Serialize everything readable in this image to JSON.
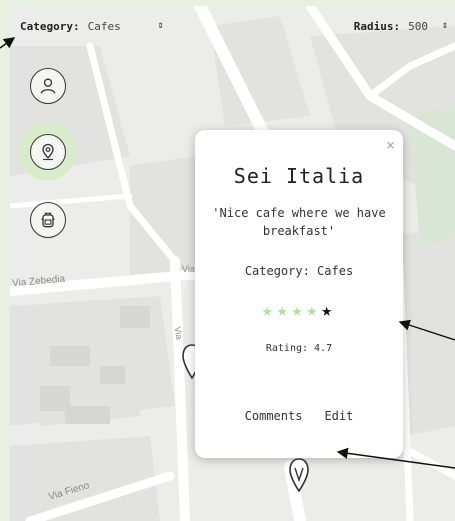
{
  "topbar": {
    "category_label": "Category:",
    "category_value": "Cafes",
    "radius_label": "Radius:",
    "radius_value": "500",
    "spinner_glyph": "⇕"
  },
  "sidebar": {
    "items": [
      {
        "name": "profile",
        "icon": "user-icon"
      },
      {
        "name": "places",
        "icon": "map-pin-icon",
        "active": true
      },
      {
        "name": "trips",
        "icon": "backpack-icon"
      }
    ],
    "active_color": "#d9ecc9"
  },
  "map": {
    "street_labels": [
      "Via Zebedia",
      "Via Fieno",
      "Via",
      "Via"
    ]
  },
  "popup": {
    "close": "×",
    "title": "Sei Italia",
    "quote": "'Nice cafe where we have breakfast'",
    "category": "Category: Cafes",
    "stars_filled": 4,
    "stars_total": 5,
    "star_glyph": "★",
    "rating": "Rating: 4.7",
    "comments_label": "Comments",
    "edit_label": "Edit"
  },
  "colors": {
    "star_filled": "#b8dca2",
    "star_active": "#111111",
    "page_background": "#e8f0df"
  }
}
